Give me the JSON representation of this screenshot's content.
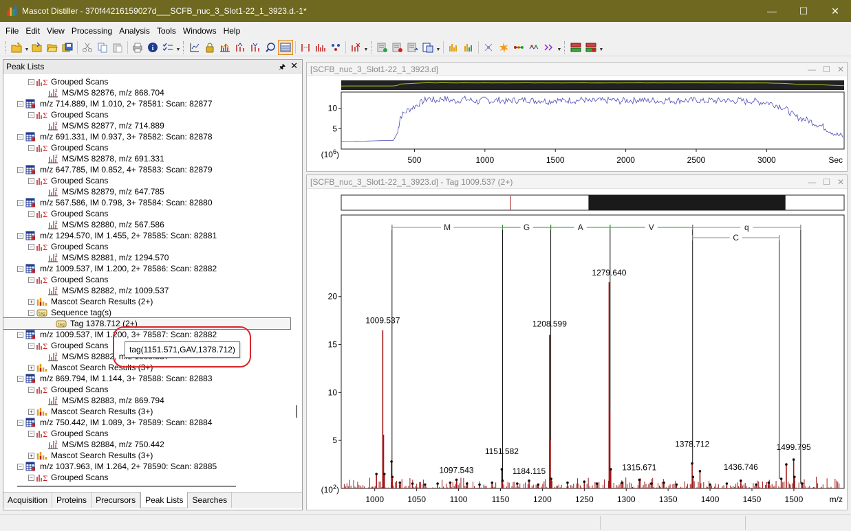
{
  "window": {
    "title": "Mascot Distiller - 370f44216159027d___SCFB_nuc_3_Slot1-22_1_3923.d.-1*"
  },
  "menu": [
    "File",
    "Edit",
    "View",
    "Processing",
    "Analysis",
    "Tools",
    "Windows",
    "Help"
  ],
  "left_pane": {
    "title": "Peak Lists",
    "tree": [
      {
        "level": 2,
        "icon": "grouped-scans-icon",
        "toggle": "−",
        "text": "Grouped Scans"
      },
      {
        "level": 3,
        "icon": "msms-spectrum-icon",
        "toggle": "",
        "text": "MS/MS 82876, m/z 868.704"
      },
      {
        "level": 1,
        "icon": "peak-list-icon",
        "toggle": "−",
        "text": "m/z 714.889, IM 1.010, 2+ 78581: Scan: 82877"
      },
      {
        "level": 2,
        "icon": "grouped-scans-icon",
        "toggle": "−",
        "text": "Grouped Scans"
      },
      {
        "level": 3,
        "icon": "msms-spectrum-icon",
        "toggle": "",
        "text": "MS/MS 82877, m/z 714.889"
      },
      {
        "level": 1,
        "icon": "peak-list-icon",
        "toggle": "−",
        "text": "m/z 691.331, IM 0.937, 3+ 78582: Scan: 82878"
      },
      {
        "level": 2,
        "icon": "grouped-scans-icon",
        "toggle": "−",
        "text": "Grouped Scans"
      },
      {
        "level": 3,
        "icon": "msms-spectrum-icon",
        "toggle": "",
        "text": "MS/MS 82878, m/z 691.331"
      },
      {
        "level": 1,
        "icon": "peak-list-icon",
        "toggle": "−",
        "text": "m/z 647.785, IM 0.852, 4+ 78583: Scan: 82879"
      },
      {
        "level": 2,
        "icon": "grouped-scans-icon",
        "toggle": "−",
        "text": "Grouped Scans"
      },
      {
        "level": 3,
        "icon": "msms-spectrum-icon",
        "toggle": "",
        "text": "MS/MS 82879, m/z 647.785"
      },
      {
        "level": 1,
        "icon": "peak-list-icon",
        "toggle": "−",
        "text": "m/z 567.586, IM 0.798, 3+ 78584: Scan: 82880"
      },
      {
        "level": 2,
        "icon": "grouped-scans-icon",
        "toggle": "−",
        "text": "Grouped Scans"
      },
      {
        "level": 3,
        "icon": "msms-spectrum-icon",
        "toggle": "",
        "text": "MS/MS 82880, m/z 567.586"
      },
      {
        "level": 1,
        "icon": "peak-list-icon",
        "toggle": "−",
        "text": "m/z 1294.570, IM 1.455, 2+ 78585: Scan: 82881"
      },
      {
        "level": 2,
        "icon": "grouped-scans-icon",
        "toggle": "−",
        "text": "Grouped Scans"
      },
      {
        "level": 3,
        "icon": "msms-spectrum-icon",
        "toggle": "",
        "text": "MS/MS 82881, m/z 1294.570"
      },
      {
        "level": 1,
        "icon": "peak-list-icon",
        "toggle": "−",
        "text": "m/z 1009.537, IM 1.200, 2+ 78586: Scan: 82882"
      },
      {
        "level": 2,
        "icon": "grouped-scans-icon",
        "toggle": "−",
        "text": "Grouped Scans"
      },
      {
        "level": 3,
        "icon": "msms-spectrum-icon",
        "toggle": "",
        "text": "MS/MS 82882, m/z 1009.537"
      },
      {
        "level": 2,
        "icon": "search-results-icon",
        "toggle": "+",
        "text": "Mascot Search Results (2+)"
      },
      {
        "level": 2,
        "icon": "sequence-tag-icon",
        "toggle": "−",
        "text": "Sequence tag(s)"
      },
      {
        "level": 3,
        "icon": "tag-icon",
        "toggle": "",
        "text": "Tag 1378.712 (2+)",
        "selected": true
      },
      {
        "level": 1,
        "icon": "peak-list-icon",
        "toggle": "−",
        "text": "m/z 1009.537, IM 1.200, 3+ 78587: Scan: 82882"
      },
      {
        "level": 2,
        "icon": "grouped-scans-icon",
        "toggle": "−",
        "text": "Grouped Scans"
      },
      {
        "level": 3,
        "icon": "msms-spectrum-icon",
        "toggle": "",
        "text": "MS/MS 82882, m/z 1009.537"
      },
      {
        "level": 2,
        "icon": "search-results-icon",
        "toggle": "+",
        "text": "Mascot Search Results (3+)"
      },
      {
        "level": 1,
        "icon": "peak-list-icon",
        "toggle": "−",
        "text": "m/z 869.794, IM 1.144, 3+ 78588: Scan: 82883"
      },
      {
        "level": 2,
        "icon": "grouped-scans-icon",
        "toggle": "−",
        "text": "Grouped Scans"
      },
      {
        "level": 3,
        "icon": "msms-spectrum-icon",
        "toggle": "",
        "text": "MS/MS 82883, m/z 869.794"
      },
      {
        "level": 2,
        "icon": "search-results-icon",
        "toggle": "+",
        "text": "Mascot Search Results (3+)"
      },
      {
        "level": 1,
        "icon": "peak-list-icon",
        "toggle": "−",
        "text": "m/z 750.442, IM 1.089, 3+ 78589: Scan: 82884"
      },
      {
        "level": 2,
        "icon": "grouped-scans-icon",
        "toggle": "−",
        "text": "Grouped Scans"
      },
      {
        "level": 3,
        "icon": "msms-spectrum-icon",
        "toggle": "",
        "text": "MS/MS 82884, m/z 750.442"
      },
      {
        "level": 2,
        "icon": "search-results-icon",
        "toggle": "+",
        "text": "Mascot Search Results (3+)"
      },
      {
        "level": 1,
        "icon": "peak-list-icon",
        "toggle": "−",
        "text": "m/z 1037.963, IM 1.264, 2+ 78590: Scan: 82885"
      },
      {
        "level": 2,
        "icon": "grouped-scans-icon",
        "toggle": "−",
        "text": "Grouped Scans"
      }
    ],
    "tabs": [
      "Acquisition",
      "Proteins",
      "Precursors",
      "Peak Lists",
      "Searches"
    ],
    "active_tab": "Peak Lists"
  },
  "tooltip": {
    "text": "tag(1151.571,GAV,1378.712)"
  },
  "chromatogram_pane": {
    "title": "[SCFB_nuc_3_Slot1-22_1_3923.d]"
  },
  "spectrum_pane": {
    "title": "[SCFB_nuc_3_Slot1-22_1_3923.d] - Tag 1009.537 (2+)"
  },
  "chart_data": [
    {
      "type": "line",
      "name": "chromatogram",
      "xlabel": "Sec",
      "x_ticks": [
        500,
        1000,
        1500,
        2000,
        2500,
        3000
      ],
      "xlim": [
        -20,
        3550
      ],
      "y_ticks": [
        "10",
        "5"
      ],
      "y_scale_label": "(10^6)",
      "ylim": [
        0,
        14
      ],
      "series_color": "#4b4bb4",
      "points": [
        [
          -20,
          1.8
        ],
        [
          100,
          1.9
        ],
        [
          200,
          2.0
        ],
        [
          300,
          2.1
        ],
        [
          350,
          2.1
        ],
        [
          380,
          4
        ],
        [
          400,
          8
        ],
        [
          450,
          9.5
        ],
        [
          500,
          10.5
        ],
        [
          550,
          11.5
        ],
        [
          600,
          12.5
        ],
        [
          650,
          11.8
        ],
        [
          700,
          12.5
        ],
        [
          750,
          12.0
        ],
        [
          800,
          11.8
        ],
        [
          850,
          12.3
        ],
        [
          900,
          12.0
        ],
        [
          950,
          11.6
        ],
        [
          1000,
          12.2
        ],
        [
          1050,
          11.8
        ],
        [
          1100,
          12.1
        ],
        [
          1150,
          11.7
        ],
        [
          1200,
          12.0
        ],
        [
          1250,
          11.9
        ],
        [
          1300,
          12.2
        ],
        [
          1350,
          11.8
        ],
        [
          1400,
          12.0
        ],
        [
          1450,
          11.7
        ],
        [
          1500,
          12.1
        ],
        [
          1550,
          11.8
        ],
        [
          1600,
          12.0
        ],
        [
          1650,
          11.9
        ],
        [
          1700,
          12.2
        ],
        [
          1750,
          11.6
        ],
        [
          1800,
          12.0
        ],
        [
          1850,
          11.8
        ],
        [
          1900,
          12.1
        ],
        [
          1950,
          11.7
        ],
        [
          2000,
          12.0
        ],
        [
          2050,
          11.9
        ],
        [
          2100,
          12.2
        ],
        [
          2150,
          11.8
        ],
        [
          2200,
          12.0
        ],
        [
          2250,
          11.7
        ],
        [
          2300,
          12.1
        ],
        [
          2350,
          11.8
        ],
        [
          2400,
          12.0
        ],
        [
          2450,
          11.9
        ],
        [
          2500,
          12.1
        ],
        [
          2550,
          11.7
        ],
        [
          2600,
          12.0
        ],
        [
          2650,
          11.8
        ],
        [
          2700,
          12.1
        ],
        [
          2750,
          11.7
        ],
        [
          2800,
          12.0
        ],
        [
          2850,
          11.6
        ],
        [
          2900,
          11.9
        ],
        [
          2950,
          11.5
        ],
        [
          3000,
          11.5
        ],
        [
          3050,
          11.0
        ],
        [
          3100,
          10.5
        ],
        [
          3150,
          9.5
        ],
        [
          3200,
          8.0
        ],
        [
          3250,
          7.5
        ],
        [
          3300,
          7.0
        ],
        [
          3350,
          6.2
        ],
        [
          3400,
          5.5
        ],
        [
          3450,
          4.5
        ],
        [
          3500,
          3.5
        ],
        [
          3550,
          3.0
        ]
      ]
    },
    {
      "type": "bar",
      "name": "ms/ms spectrum",
      "xlabel": "m/z",
      "x_ticks": [
        1000,
        1050,
        1100,
        1150,
        1200,
        1250,
        1300,
        1350,
        1400,
        1450,
        1500
      ],
      "xlim": [
        960,
        1560
      ],
      "y_ticks": [
        5,
        10,
        15,
        20
      ],
      "y_scale_label": "(10^2)",
      "ylim": [
        0,
        28.5
      ],
      "series_color": "#a01818",
      "peaks": [
        [
          1002,
          1.5
        ],
        [
          1009.537,
          16.5
        ],
        [
          1010.5,
          5.6
        ],
        [
          1011.5,
          1.5
        ],
        [
          1020,
          2.8
        ],
        [
          1021,
          1.2
        ],
        [
          1030,
          0.6
        ],
        [
          1045,
          0.5
        ],
        [
          1060,
          0.4
        ],
        [
          1075,
          0.5
        ],
        [
          1090,
          0.6
        ],
        [
          1097.543,
          0.9
        ],
        [
          1110,
          0.5
        ],
        [
          1125,
          0.4
        ],
        [
          1140,
          0.6
        ],
        [
          1151.582,
          2.0
        ],
        [
          1152.5,
          0.8
        ],
        [
          1170,
          0.5
        ],
        [
          1184.115,
          0.8
        ],
        [
          1195,
          0.4
        ],
        [
          1208.599,
          16.0
        ],
        [
          1209.5,
          5.0
        ],
        [
          1210.5,
          1.0
        ],
        [
          1230,
          0.6
        ],
        [
          1250,
          0.7
        ],
        [
          1265,
          0.5
        ],
        [
          1279.64,
          21.5
        ],
        [
          1280.6,
          8.0
        ],
        [
          1281.6,
          2.0
        ],
        [
          1295,
          0.6
        ],
        [
          1315.671,
          0.9
        ],
        [
          1330,
          0.5
        ],
        [
          1345,
          0.6
        ],
        [
          1360,
          0.4
        ],
        [
          1378.712,
          2.6
        ],
        [
          1379.7,
          1.2
        ],
        [
          1388,
          1.8
        ],
        [
          1400,
          0.4
        ],
        [
          1420,
          0.5
        ],
        [
          1436.746,
          0.8
        ],
        [
          1455,
          0.4
        ],
        [
          1470,
          0.6
        ],
        [
          1485,
          1.0
        ],
        [
          1491,
          2.5
        ],
        [
          1499.795,
          3.0
        ],
        [
          1500.8,
          1.2
        ],
        [
          1510,
          0.5
        ]
      ],
      "labels": [
        "1009.537",
        "1097.543",
        "1151.582",
        "1184.115",
        "1208.599",
        "1279.640",
        "1315.671",
        "1378.712",
        "1436.746",
        "1499.795"
      ],
      "tag_ladder": [
        {
          "from": 1020.6,
          "to": 1152.5,
          "residue": "M",
          "color": "#888888"
        },
        {
          "from": 1152.5,
          "to": 1210.0,
          "residue": "G",
          "color": "#2a9a2a"
        },
        {
          "from": 1210.0,
          "to": 1280.8,
          "residue": "A",
          "color": "#2a9a2a"
        },
        {
          "from": 1280.8,
          "to": 1379.2,
          "residue": "V",
          "color": "#2a9a2a"
        },
        {
          "from": 1379.2,
          "to": 1508.2,
          "residue": "q",
          "color": "#888888"
        },
        {
          "from": 1379.2,
          "to": 1482.5,
          "residue": "C",
          "color": "#888888"
        }
      ]
    }
  ],
  "colors": {
    "title_bar": "#6e6820",
    "spectrum_peak": "#a01818",
    "tag_highlight": "#2a9a2a",
    "tooltip_ring": "#d7262a"
  }
}
